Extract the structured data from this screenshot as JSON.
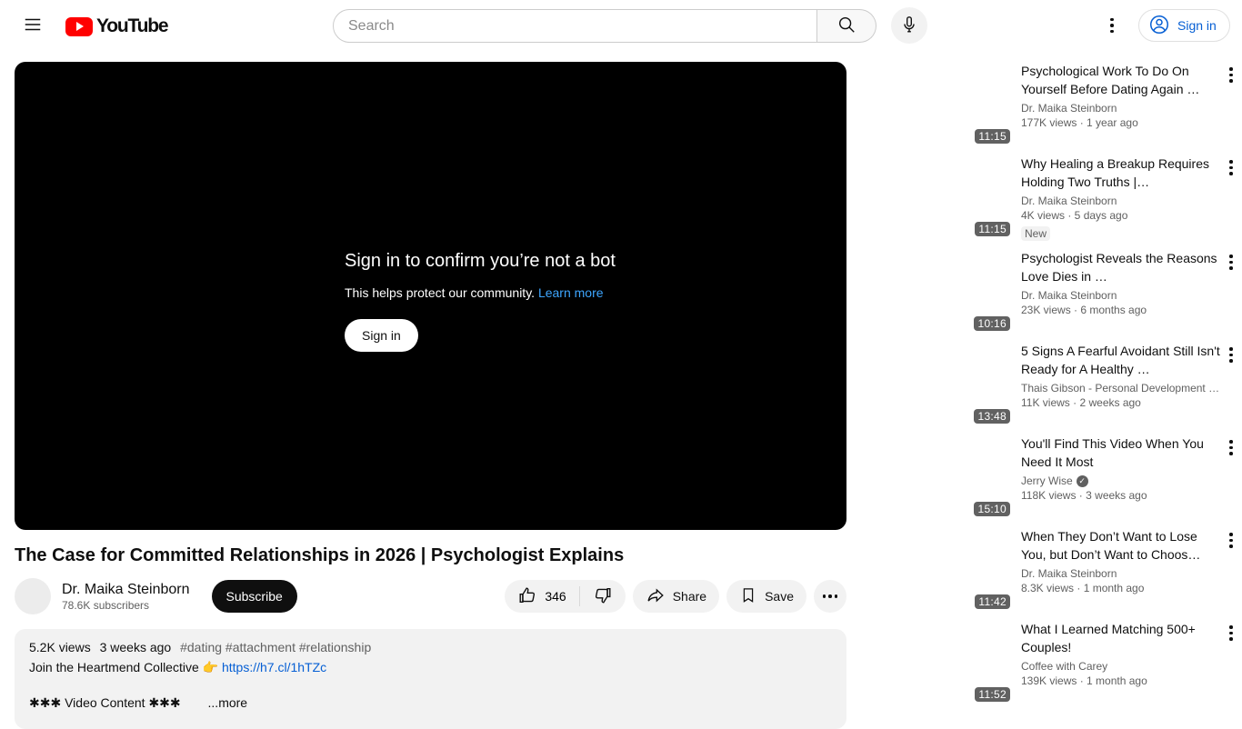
{
  "colors": {
    "youtube_red": "#ff0000",
    "link_blue": "#065fd4",
    "overlay_link_blue": "#3ea6ff",
    "player_bg": "#000000",
    "pill_gray": "#f2f2f2"
  },
  "header": {
    "logo_text": "YouTube",
    "search_placeholder": "Search",
    "sign_in_label": "Sign in"
  },
  "player_overlay": {
    "title": "Sign in to confirm you’re not a bot",
    "subtitle": "This helps protect our community.",
    "link_label": "Learn more",
    "button_label": "Sign in"
  },
  "video": {
    "title": "The Case for Committed Relationships in 2026 | Psychologist Explains",
    "channel_name": "Dr. Maika Steinborn",
    "subscribers": "78.6K subscribers",
    "subscribe_label": "Subscribe",
    "like_count": "346",
    "share_label": "Share",
    "save_label": "Save"
  },
  "description": {
    "views": "5.2K views",
    "date": "3 weeks ago",
    "hashtags": "#dating #attachment #relationship",
    "promo_text": "Join the Heartmend Collective",
    "pointer_emoji": "👉",
    "promo_link": "https://h7.cl/1hTZc",
    "content_line": "✱✱✱ Video Content ✱✱✱",
    "more_label": "...more"
  },
  "recommended": [
    {
      "title": "Psychological Work To Do On Yourself Before Dating Again …",
      "channel": "Dr. Maika Steinborn",
      "meta": "177K views · 1 year ago",
      "duration": "11:15",
      "badge": "",
      "verified": false
    },
    {
      "title": "Why Healing a Breakup Requires Holding Two Truths |…",
      "channel": "Dr. Maika Steinborn",
      "meta": "4K views · 5 days ago",
      "duration": "11:15",
      "badge": "New",
      "verified": false
    },
    {
      "title": "Psychologist Reveals the Reasons Love Dies in …",
      "channel": "Dr. Maika Steinborn",
      "meta": "23K views · 6 months ago",
      "duration": "10:16",
      "badge": "",
      "verified": false
    },
    {
      "title": "5 Signs A Fearful Avoidant Still Isn't Ready for A Healthy …",
      "channel": "Thais Gibson - Personal Development …",
      "meta": "11K views · 2 weeks ago",
      "duration": "13:48",
      "badge": "",
      "verified": false
    },
    {
      "title": "You'll Find This Video When You Need It Most",
      "channel": "Jerry Wise",
      "meta": "118K views · 3 weeks ago",
      "duration": "15:10",
      "badge": "",
      "verified": true
    },
    {
      "title": "When They Don’t Want to Lose You, but Don’t Want to Choos…",
      "channel": "Dr. Maika Steinborn",
      "meta": "8.3K views · 1 month ago",
      "duration": "11:42",
      "badge": "",
      "verified": false
    },
    {
      "title": "What I Learned Matching 500+ Couples!",
      "channel": "Coffee with Carey",
      "meta": "139K views · 1 month ago",
      "duration": "11:52",
      "badge": "",
      "verified": false
    }
  ]
}
